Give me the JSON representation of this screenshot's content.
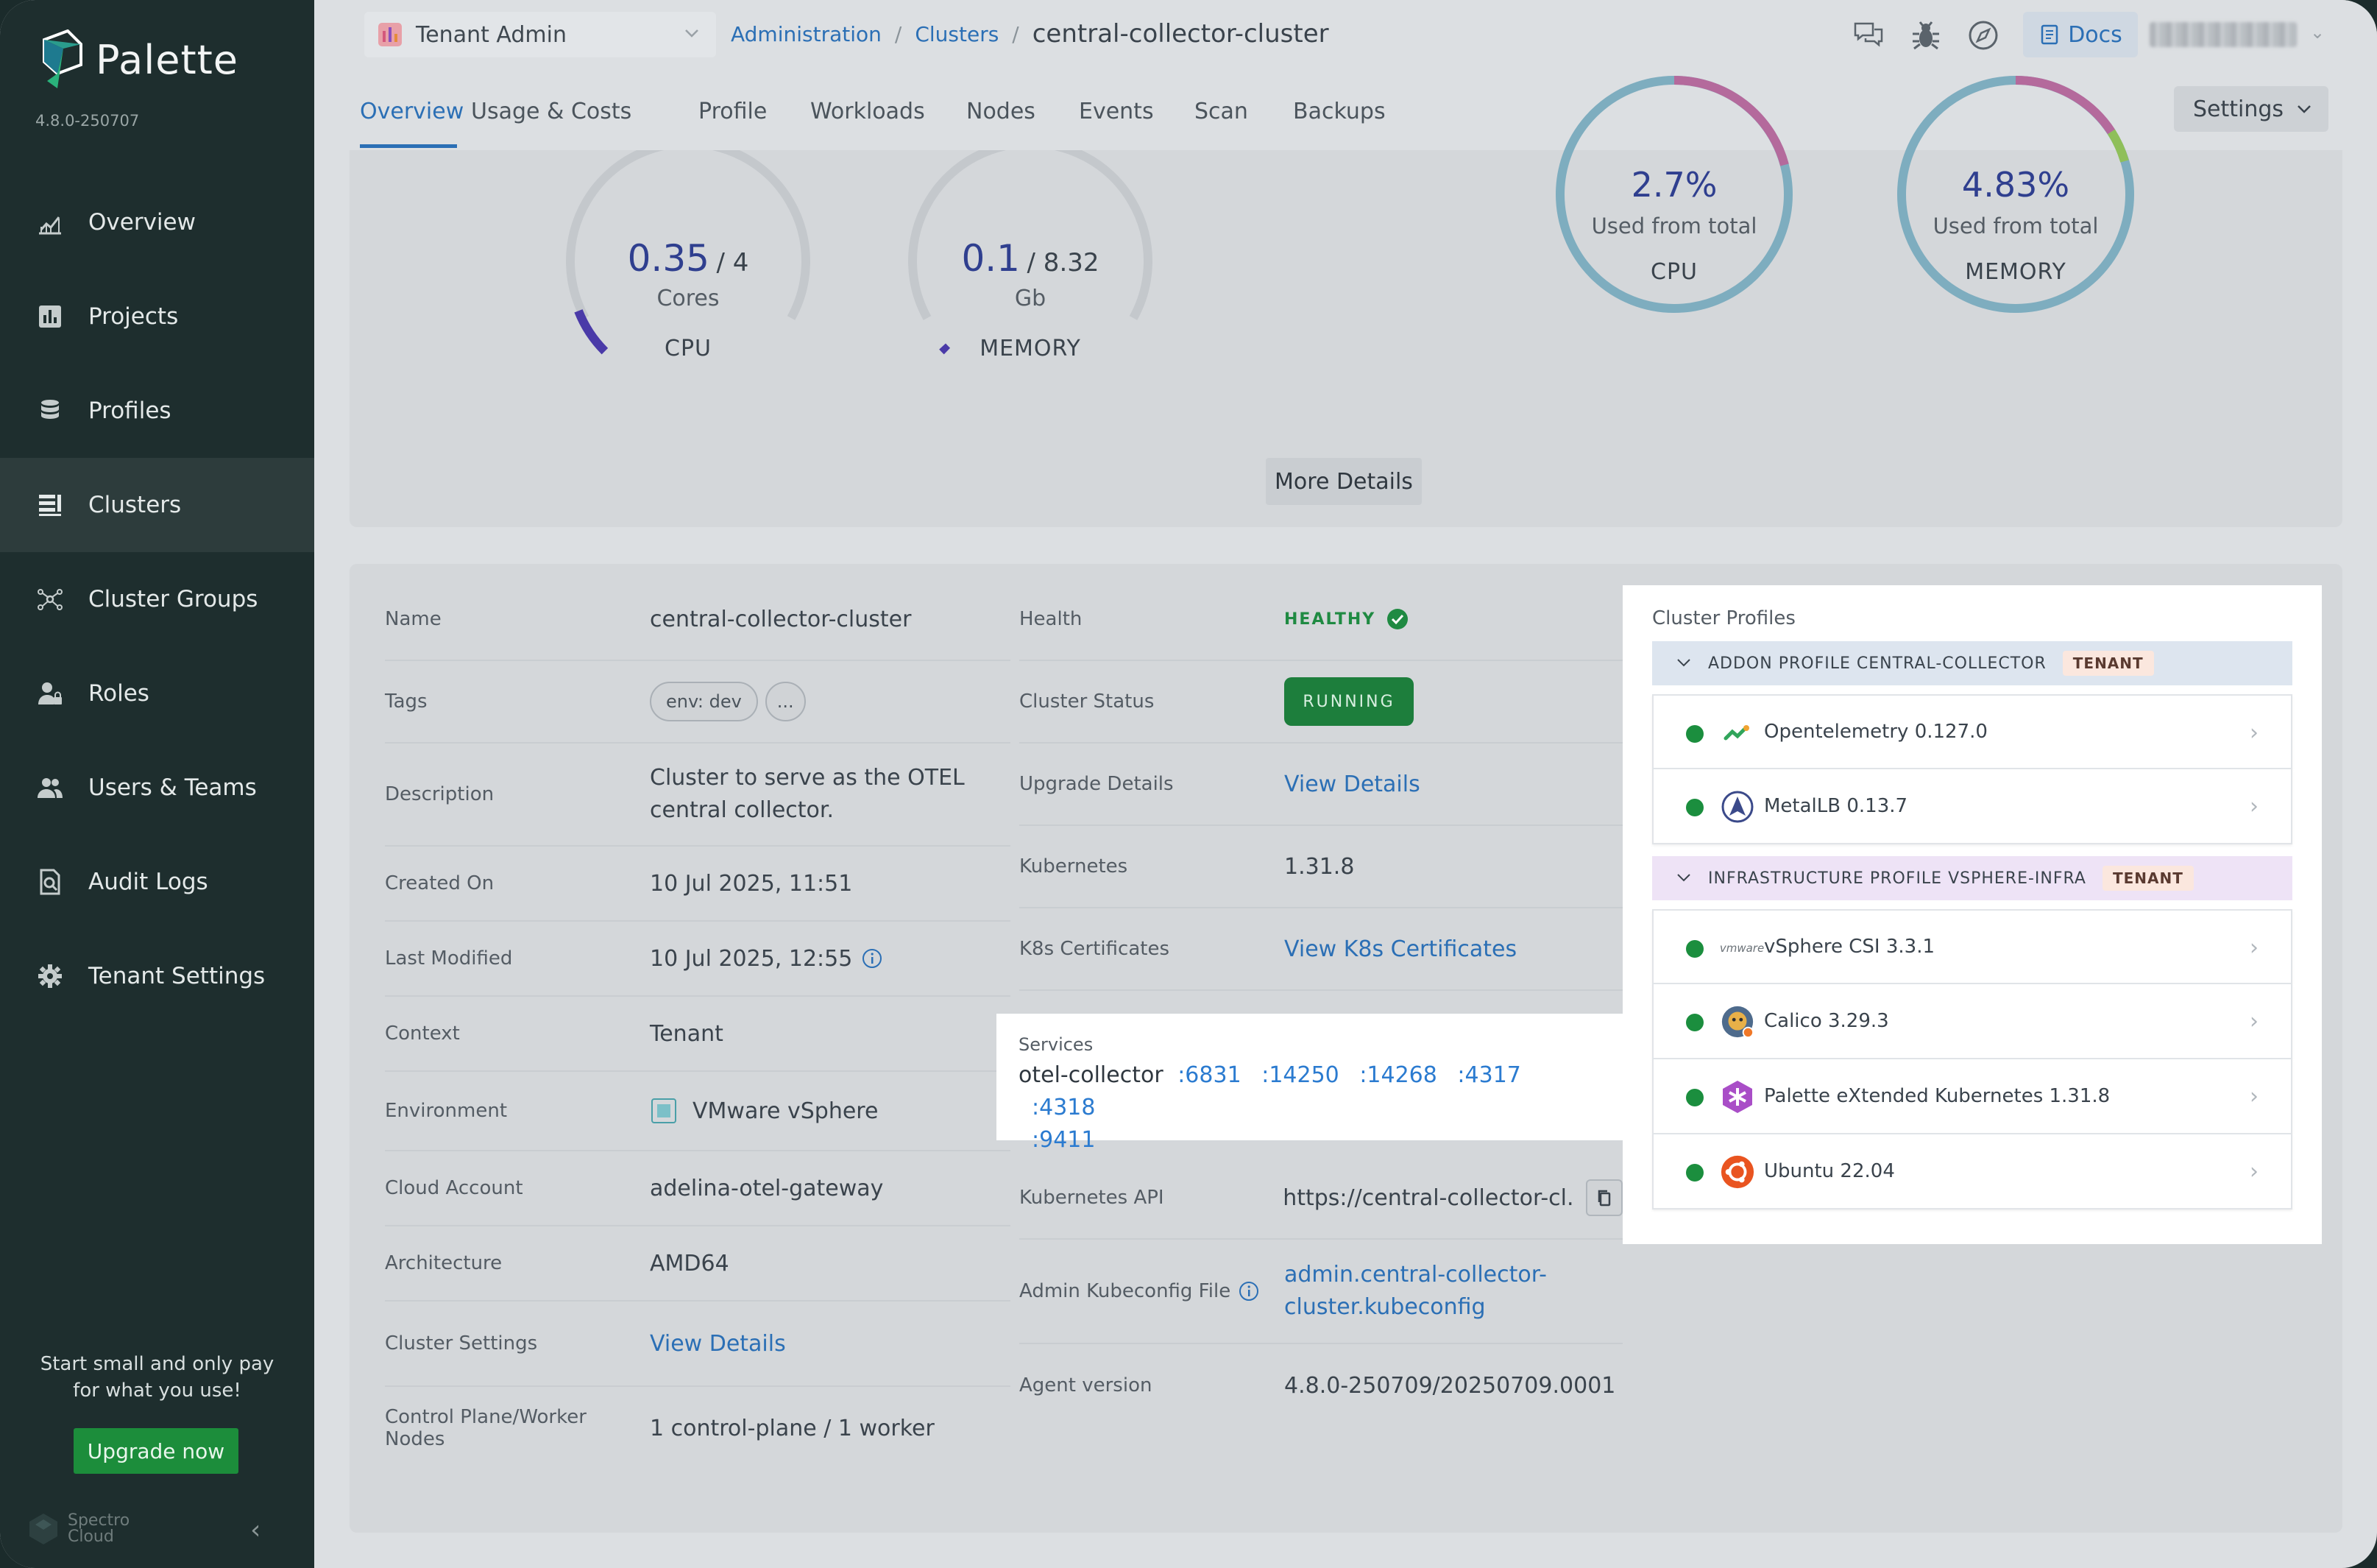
{
  "app": {
    "name": "Palette",
    "version": "4.8.0-250707"
  },
  "sidebar": {
    "items": [
      {
        "label": "Overview",
        "icon": "chart-icon"
      },
      {
        "label": "Projects",
        "icon": "bar-chart-icon"
      },
      {
        "label": "Profiles",
        "icon": "database-icon"
      },
      {
        "label": "Clusters",
        "icon": "cluster-list-icon",
        "active": true
      },
      {
        "label": "Cluster Groups",
        "icon": "network-icon"
      },
      {
        "label": "Roles",
        "icon": "user-lock-icon"
      },
      {
        "label": "Users & Teams",
        "icon": "users-icon"
      },
      {
        "label": "Audit Logs",
        "icon": "audit-icon"
      },
      {
        "label": "Tenant Settings",
        "icon": "gear-icon"
      }
    ],
    "promo": {
      "line1": "Start small and only pay",
      "line2": "for what you use!"
    },
    "upgrade_label": "Upgrade now",
    "brand": {
      "line1": "Spectro",
      "line2": "Cloud"
    }
  },
  "header": {
    "tenant": "Tenant Admin",
    "breadcrumb": [
      "Administration",
      "Clusters"
    ],
    "current": "central-collector-cluster",
    "docs_label": "Docs"
  },
  "tabs": {
    "items": [
      "Overview",
      "Usage & Costs",
      "Profile",
      "Workloads",
      "Nodes",
      "Events",
      "Scan",
      "Backups"
    ],
    "active": "Overview",
    "settings_label": "Settings"
  },
  "usage": {
    "cpu": {
      "value": "0.35",
      "total": "/ 4",
      "unit": "Cores",
      "label": "CPU",
      "fraction": 0.0875
    },
    "memory": {
      "value": "0.1",
      "total": "/ 8.32",
      "unit": "Gb",
      "label": "MEMORY",
      "fraction": 0.012
    },
    "cpu_total": {
      "percent": "2.7%",
      "caption": "Used from total",
      "label": "CPU"
    },
    "memory_total": {
      "percent": "4.83%",
      "caption": "Used from total",
      "label": "MEMORY"
    },
    "more_details": "More Details"
  },
  "details": {
    "name": {
      "label": "Name",
      "value": "central-collector-cluster"
    },
    "tags": {
      "label": "Tags",
      "values": [
        "env: dev",
        "..."
      ]
    },
    "description": {
      "label": "Description",
      "line1": "Cluster to serve as the OTEL",
      "line2": "central collector."
    },
    "created": {
      "label": "Created On",
      "value": "10 Jul 2025, 11:51"
    },
    "modified": {
      "label": "Last Modified",
      "value": "10 Jul 2025, 12:55"
    },
    "context": {
      "label": "Context",
      "value": "Tenant"
    },
    "environment": {
      "label": "Environment",
      "value": "VMware vSphere"
    },
    "cloud_account": {
      "label": "Cloud Account",
      "value": "adelina-otel-gateway"
    },
    "architecture": {
      "label": "Architecture",
      "value": "AMD64"
    },
    "cluster_settings": {
      "label": "Cluster Settings",
      "value": "View Details"
    },
    "nodes": {
      "label": "Control Plane/Worker Nodes",
      "value": "1 control-plane / 1 worker"
    },
    "health": {
      "label": "Health",
      "value": "HEALTHY"
    },
    "status": {
      "label": "Cluster Status",
      "value": "RUNNING"
    },
    "upgrade": {
      "label": "Upgrade Details",
      "value": "View Details"
    },
    "kubernetes": {
      "label": "Kubernetes",
      "value": "1.31.8"
    },
    "k8s_certs": {
      "label": "K8s Certificates",
      "value": "View K8s Certificates"
    },
    "k8s_api": {
      "label": "Kubernetes API",
      "value": "https://central-collector-cl..."
    },
    "kubeconfig": {
      "label": "Admin Kubeconfig File",
      "line1": "admin.central-collector-",
      "line2": "cluster.kubeconfig"
    },
    "agent": {
      "label": "Agent version",
      "value": "4.8.0-250709/20250709.0001"
    }
  },
  "services": {
    "title": "Services",
    "name": "otel-collector",
    "ports": [
      ":6831",
      ":14250",
      ":14268",
      ":4317",
      ":4318",
      ":9411"
    ]
  },
  "profiles": {
    "title": "Cluster Profiles",
    "groups": [
      {
        "header": "ADDON PROFILE CENTRAL-COLLECTOR",
        "tag": "TENANT",
        "packs": [
          "Opentelemetry 0.127.0",
          "MetalLB 0.13.7"
        ]
      },
      {
        "header": "INFRASTRUCTURE PROFILE VSPHERE-INFRA",
        "tag": "TENANT",
        "packs": [
          "vSphere CSI 3.3.1",
          "Calico 3.29.3",
          "Palette eXtended Kubernetes 1.31.8",
          "Ubuntu 22.04"
        ]
      }
    ],
    "vmware_logo_text": "vmware"
  },
  "colors": {
    "accent": "#2b6fb5",
    "success": "#1b8e3e",
    "sidebar": "#1e2e2e",
    "gauge_cpu": "#4a3aa8",
    "ring": "#6fa9bd"
  }
}
